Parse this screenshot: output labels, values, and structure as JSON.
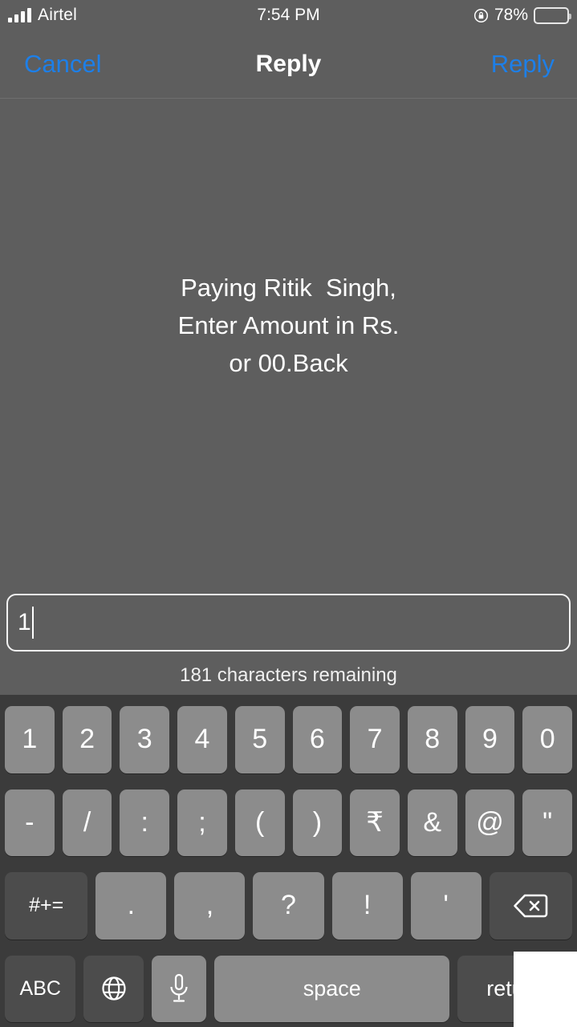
{
  "status_bar": {
    "carrier": "Airtel",
    "signal_icon": "signal-bars-icon",
    "time": "7:54 PM",
    "rotation_lock_icon": "rotation-lock-icon",
    "battery_percent": "78%",
    "battery_icon": "battery-icon",
    "battery_level": 88
  },
  "nav_bar": {
    "cancel_label": "Cancel",
    "title": "Reply",
    "reply_label": "Reply",
    "accent_color": "#1d7fe8",
    "title_color": "#ffffff"
  },
  "message": {
    "body": "Paying Ritik  Singh,\nEnter Amount in Rs.\nor 00.Back"
  },
  "input": {
    "value": "1",
    "placeholder": "",
    "char_count_label": "181 characters remaining"
  },
  "keyboard": {
    "background_color": "#3b3b3b",
    "key_color": "#8c8c8c",
    "modifier_key_color": "#4c4c4c",
    "row1": [
      {
        "label": "1",
        "name": "key-1"
      },
      {
        "label": "2",
        "name": "key-2"
      },
      {
        "label": "3",
        "name": "key-3"
      },
      {
        "label": "4",
        "name": "key-4"
      },
      {
        "label": "5",
        "name": "key-5"
      },
      {
        "label": "6",
        "name": "key-6"
      },
      {
        "label": "7",
        "name": "key-7"
      },
      {
        "label": "8",
        "name": "key-8"
      },
      {
        "label": "9",
        "name": "key-9"
      },
      {
        "label": "0",
        "name": "key-0"
      }
    ],
    "row2": [
      {
        "label": "-",
        "name": "key-hyphen"
      },
      {
        "label": "/",
        "name": "key-slash"
      },
      {
        "label": ":",
        "name": "key-colon"
      },
      {
        "label": ";",
        "name": "key-semicolon"
      },
      {
        "label": "(",
        "name": "key-open-paren"
      },
      {
        "label": ")",
        "name": "key-close-paren"
      },
      {
        "label": "₹",
        "name": "key-rupee"
      },
      {
        "label": "&",
        "name": "key-ampersand"
      },
      {
        "label": "@",
        "name": "key-at"
      },
      {
        "label": "\"",
        "name": "key-double-quote"
      }
    ],
    "row3": [
      {
        "label": "#+=",
        "name": "key-symbols-toggle"
      },
      {
        "label": ".",
        "name": "key-period"
      },
      {
        "label": ",",
        "name": "key-comma"
      },
      {
        "label": "?",
        "name": "key-question-mark"
      },
      {
        "label": "!",
        "name": "key-exclamation"
      },
      {
        "label": "'",
        "name": "key-apostrophe"
      },
      {
        "label": "",
        "name": "key-backspace"
      }
    ],
    "row4": {
      "abc_label": "ABC",
      "globe_icon": "globe-icon",
      "mic_icon": "microphone-icon",
      "space_label": "space",
      "return_label": "return"
    }
  }
}
